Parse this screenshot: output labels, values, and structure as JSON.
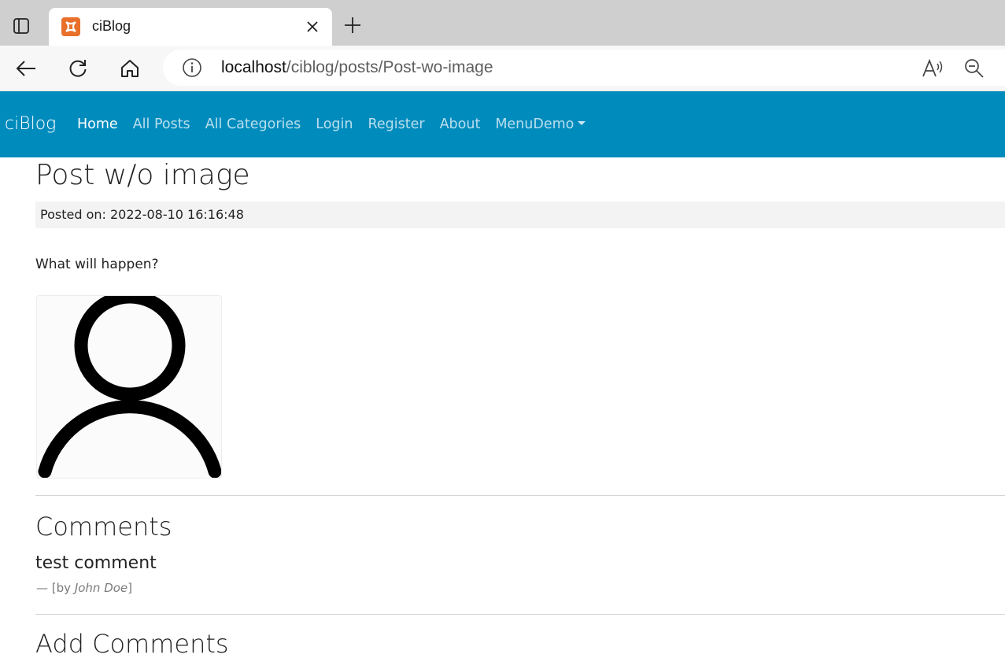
{
  "browser": {
    "tab_title": "ciBlog",
    "url_host": "localhost",
    "url_path": "/ciblog/posts/Post-wo-image",
    "favicon_color": "#e8702a"
  },
  "navbar": {
    "brand": "ciBlog",
    "background": "#008bbd",
    "links": [
      "Home",
      "All Posts",
      "All Categories",
      "Login",
      "Register",
      "About",
      "MenuDemo"
    ],
    "active": "Home"
  },
  "post": {
    "title": "Post w/o image",
    "posted_label": "Posted on: 2022-08-10 16:16:48",
    "body": "What will happen?",
    "image_icon": "user-placeholder-icon"
  },
  "comments": {
    "heading": "Comments",
    "items": [
      {
        "text": "test comment",
        "dash": "—",
        "by_prefix": "[by ",
        "author": "John Doe",
        "by_suffix": "]"
      }
    ]
  },
  "add_comments": {
    "heading": "Add Comments"
  }
}
